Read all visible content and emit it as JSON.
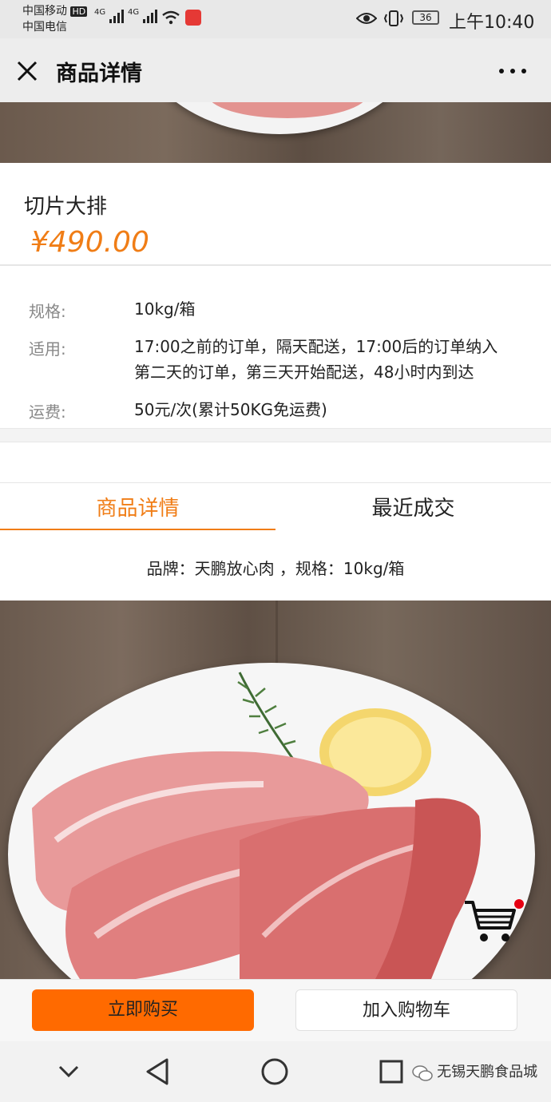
{
  "status_bar": {
    "carrier1": "中国移动",
    "hd": "HD",
    "carrier2": "中国电信",
    "signal1": "4G",
    "signal2": "4G",
    "battery": "36",
    "time": "上午10:40"
  },
  "nav": {
    "title": "商品详情"
  },
  "product": {
    "name": "切片大排",
    "price": "¥490.00"
  },
  "specs": [
    {
      "label": "规格:",
      "value": "10kg/箱"
    },
    {
      "label": "适用:",
      "value_line1": "17:00之前的订单，隔天配送，17:00后的订单纳入",
      "value_line2": "第二天的订单，第三天开始配送，48小时内到达"
    },
    {
      "label": "运费:",
      "value": "50元/次(累计50KG免运费)"
    }
  ],
  "tabs": [
    {
      "label": "商品详情",
      "active": true
    },
    {
      "label": "最近成交",
      "active": false
    }
  ],
  "detail": {
    "brand_line": "品牌：天鹏放心肉 ，规格：10kg/箱"
  },
  "actions": {
    "buy_now": "立即购买",
    "add_to_cart": "加入购物车"
  },
  "watermark": "无锡天鹏食品城",
  "colors": {
    "accent": "#f07d16",
    "buy_button": "#ff6a00",
    "cart_badge": "#e60012"
  }
}
